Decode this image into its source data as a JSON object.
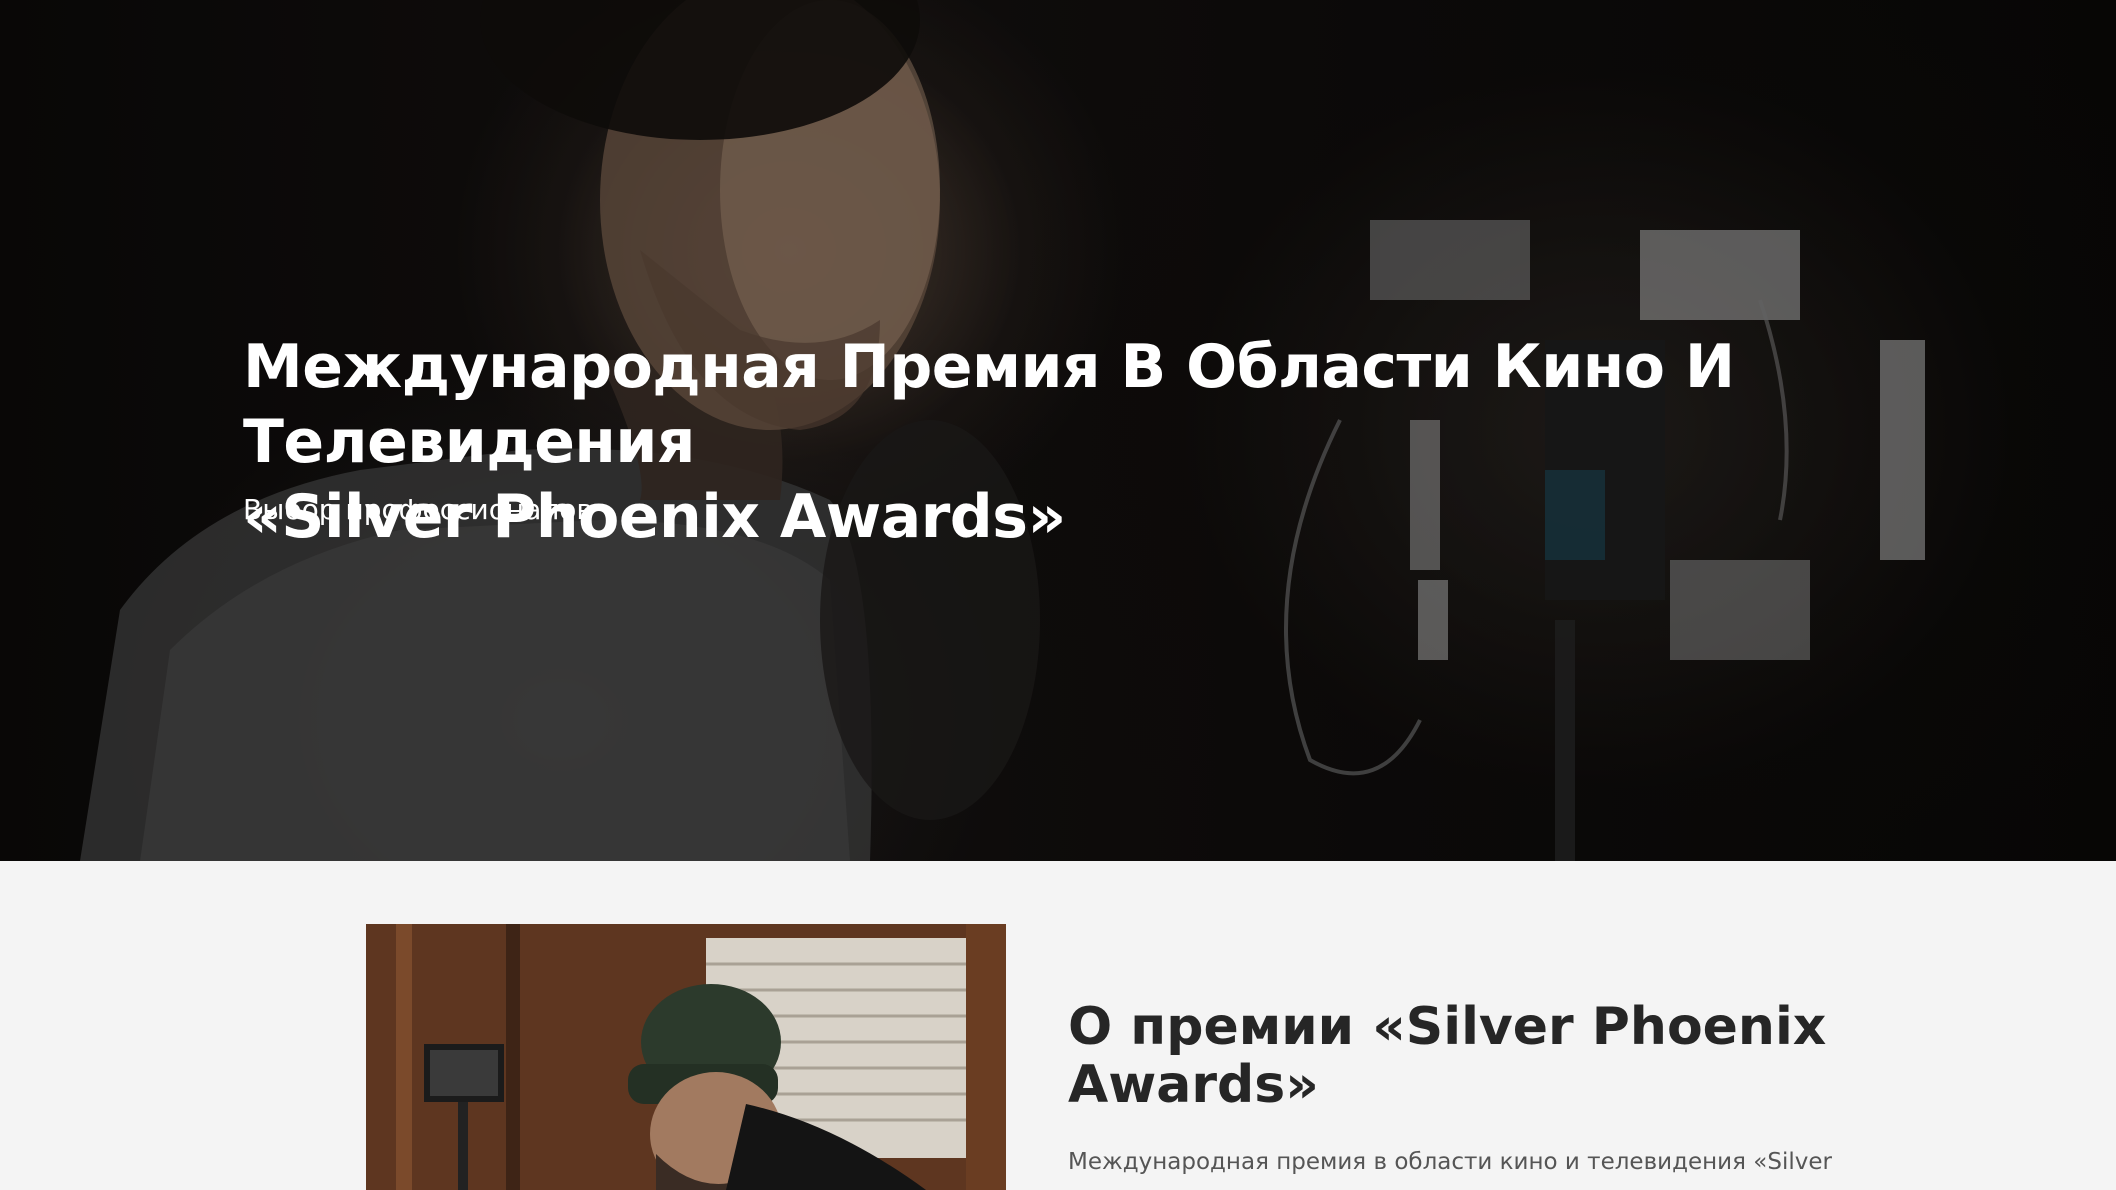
{
  "hero": {
    "title_line1": "Международная Премия В Области Кино И Телевидения",
    "title_line2": "«Silver Phoenix Awards»",
    "subtitle": "Выбор профессионалов",
    "background_image": "filmmaker-with-camera-photo"
  },
  "about": {
    "title": "О премии «Silver Phoenix Awards»",
    "text": "Международная премия в области кино и телевидения «Silver",
    "image": "cameraman-in-beanie-photo"
  },
  "colors": {
    "hero_text": "#ffffff",
    "about_background": "#f4f4f4",
    "about_title": "#262626",
    "about_text": "#555555"
  }
}
